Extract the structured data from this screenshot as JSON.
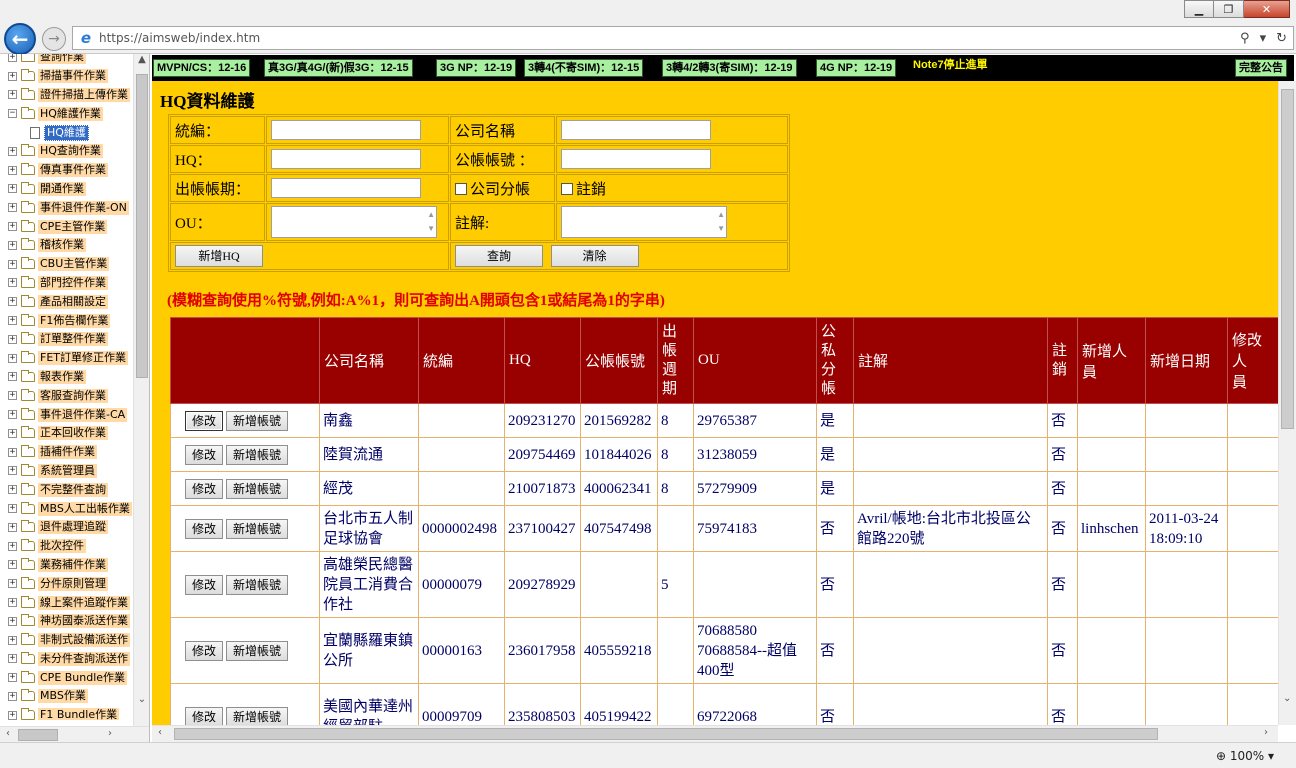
{
  "browser": {
    "url": "https://aimsweb/index.htm",
    "window_controls": {
      "minimize": "▁",
      "maximize": "❐",
      "close": "✕"
    },
    "zoom": "100%"
  },
  "sidebar": {
    "items": [
      {
        "label": "查詢作業",
        "expander": "+"
      },
      {
        "label": "掃描事件作業",
        "expander": "+"
      },
      {
        "label": "證件掃描上傳作業",
        "expander": "+"
      },
      {
        "label": "HQ維護作業",
        "expander": "−"
      },
      {
        "label": "HQ查詢作業",
        "expander": "+"
      },
      {
        "label": "傳真事件作業",
        "expander": "+"
      },
      {
        "label": "開通作業",
        "expander": "+"
      },
      {
        "label": "事件退件作業-ON",
        "expander": "+"
      },
      {
        "label": "CPE主管作業",
        "expander": "+"
      },
      {
        "label": "稽核作業",
        "expander": "+"
      },
      {
        "label": "CBU主管作業",
        "expander": "+"
      },
      {
        "label": "部門控件作業",
        "expander": "+"
      },
      {
        "label": "產品相關設定",
        "expander": "+"
      },
      {
        "label": "F1佈告欄作業",
        "expander": "+"
      },
      {
        "label": "訂單整件作業",
        "expander": "+"
      },
      {
        "label": "FET訂單修正作業",
        "expander": "+"
      },
      {
        "label": "報表作業",
        "expander": "+"
      },
      {
        "label": "客服查詢作業",
        "expander": "+"
      },
      {
        "label": "事件退件作業-CA",
        "expander": "+"
      },
      {
        "label": "正本回收作業",
        "expander": "+"
      },
      {
        "label": "插補件作業",
        "expander": "+"
      },
      {
        "label": "系統管理員",
        "expander": "+"
      },
      {
        "label": "不完整件查詢",
        "expander": "+"
      },
      {
        "label": "MBS人工出帳作業",
        "expander": "+"
      },
      {
        "label": "退件處理追蹤",
        "expander": "+"
      },
      {
        "label": "批次控件",
        "expander": "+"
      },
      {
        "label": "業務補件作業",
        "expander": "+"
      },
      {
        "label": "分件原則管理",
        "expander": "+"
      },
      {
        "label": "線上案件追蹤作業",
        "expander": "+"
      },
      {
        "label": "神坊國泰派送作業",
        "expander": "+"
      },
      {
        "label": "非制式設備派送作",
        "expander": "+"
      },
      {
        "label": "未分件查詢派送作",
        "expander": "+"
      },
      {
        "label": "CPE Bundle作業",
        "expander": "+"
      },
      {
        "label": "MBS作業",
        "expander": "+"
      },
      {
        "label": "F1 Bundle作業",
        "expander": "+"
      }
    ],
    "selected_child": "HQ維護"
  },
  "ticker": {
    "items": [
      "MVPN/CS：12-16",
      "真3G/真4G/(新)假3G：12-15",
      "3G NP：12-19",
      "3轉4(不寄SIM)：12-15",
      "3轉4/2轉3(寄SIM)：12-19",
      "4G NP：12-19"
    ],
    "warning": "Note7停止進單",
    "notice": "完整公告"
  },
  "page": {
    "title": "HQ資料維護",
    "hint": "(模糊查詢使用%符號,例如:A%1，則可查詢出A開頭包含1或結尾為1的字串)"
  },
  "form": {
    "tax_id_label": "統編：",
    "company_label": "公司名稱",
    "hq_label": "HQ：",
    "account_label": "公帳帳號 ：",
    "cycle_label": "出帳帳期：",
    "company_split_label": "公司分帳",
    "cancel_label": "註銷",
    "ou_label": "OU：",
    "note_label": "註解:",
    "add_hq_button": "新增HQ",
    "query_button": "查詢",
    "clear_button": "清除"
  },
  "table": {
    "headers": {
      "action": "",
      "company": "公司名稱",
      "tax_id": "統編",
      "hq": "HQ",
      "account": "公帳帳號",
      "cycle": "出\n帳\n週\n期",
      "ou": "OU",
      "split": "公\n私\n分\n帳",
      "note": "註解",
      "cancel": "註\n銷",
      "creator": "新增人\n員",
      "created": "新增日期",
      "modifier": "修改人\n員"
    },
    "edit_label": "修改",
    "add_account_label": "新增帳號",
    "rows": [
      {
        "company": "南鑫",
        "tax_id": "",
        "hq": "209231270",
        "account": "201569282",
        "cycle": "8",
        "ou": "29765387",
        "split": "是",
        "note": "",
        "cancel": "否",
        "creator": "",
        "created": ""
      },
      {
        "company": "陸賀流通",
        "tax_id": "",
        "hq": "209754469",
        "account": "101844026",
        "cycle": "8",
        "ou": "31238059",
        "split": "是",
        "note": "",
        "cancel": "否",
        "creator": "",
        "created": ""
      },
      {
        "company": "經茂",
        "tax_id": "",
        "hq": "210071873",
        "account": "400062341",
        "cycle": "8",
        "ou": "57279909",
        "split": "是",
        "note": "",
        "cancel": "否",
        "creator": "",
        "created": ""
      },
      {
        "company": "台北市五人制足球協會",
        "tax_id": "0000002498",
        "hq": "237100427",
        "account": "407547498",
        "cycle": "",
        "ou": "75974183",
        "split": "否",
        "note": "Avril/帳地:台北市北投區公館路220號",
        "cancel": "否",
        "creator": "linhschen",
        "created": "2011-03-24 18:09:10"
      },
      {
        "company": "高雄榮民總醫院員工消費合作社",
        "tax_id": "00000079",
        "hq": "209278929",
        "account": "",
        "cycle": "5",
        "ou": "",
        "split": "否",
        "note": "",
        "cancel": "否",
        "creator": "",
        "created": ""
      },
      {
        "company": "宜蘭縣羅東鎮公所",
        "tax_id": "00000163",
        "hq": "236017958",
        "account": "405559218",
        "cycle": "",
        "ou": "70688580 70688584--超值400型",
        "split": "否",
        "note": "",
        "cancel": "否",
        "creator": "",
        "created": ""
      },
      {
        "company": "美國內華達州經貿部駐",
        "tax_id": "00009709",
        "hq": "235808503",
        "account": "405199422",
        "cycle": "",
        "ou": "69722068",
        "split": "否",
        "note": "",
        "cancel": "否",
        "creator": "",
        "created": ""
      }
    ]
  },
  "colors": {
    "main_bg": "#ffcc00",
    "header_bg": "#990000",
    "hint": "#e00000",
    "ticker_bg": "#000000",
    "ticker_item": "#a8f0a0",
    "ticker_warning": "#fff700",
    "tree_label_bg": "#ffd9a6"
  },
  "icons": {
    "back": "back-arrow-icon",
    "forward": "forward-arrow-icon",
    "browser": "ie-icon",
    "search": "search-icon",
    "refresh": "refresh-icon",
    "zoom": "zoom-icon",
    "folder": "folder-icon"
  }
}
